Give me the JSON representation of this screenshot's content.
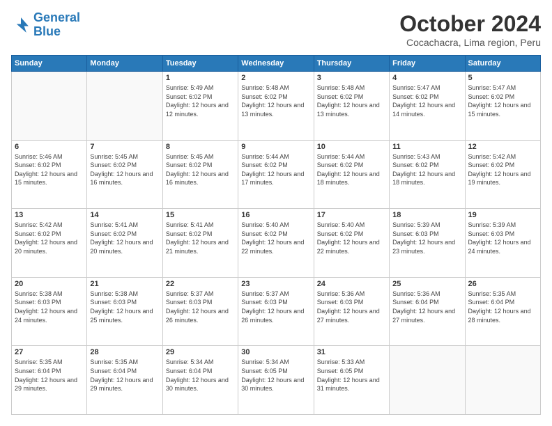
{
  "logo": {
    "line1": "General",
    "line2": "Blue"
  },
  "title": "October 2024",
  "subtitle": "Cocachacra, Lima region, Peru",
  "weekdays": [
    "Sunday",
    "Monday",
    "Tuesday",
    "Wednesday",
    "Thursday",
    "Friday",
    "Saturday"
  ],
  "weeks": [
    [
      {
        "day": "",
        "empty": true
      },
      {
        "day": "",
        "empty": true
      },
      {
        "day": "1",
        "sunrise": "5:49 AM",
        "sunset": "6:02 PM",
        "daylight": "12 hours and 12 minutes."
      },
      {
        "day": "2",
        "sunrise": "5:48 AM",
        "sunset": "6:02 PM",
        "daylight": "12 hours and 13 minutes."
      },
      {
        "day": "3",
        "sunrise": "5:48 AM",
        "sunset": "6:02 PM",
        "daylight": "12 hours and 13 minutes."
      },
      {
        "day": "4",
        "sunrise": "5:47 AM",
        "sunset": "6:02 PM",
        "daylight": "12 hours and 14 minutes."
      },
      {
        "day": "5",
        "sunrise": "5:47 AM",
        "sunset": "6:02 PM",
        "daylight": "12 hours and 15 minutes."
      }
    ],
    [
      {
        "day": "6",
        "sunrise": "5:46 AM",
        "sunset": "6:02 PM",
        "daylight": "12 hours and 15 minutes."
      },
      {
        "day": "7",
        "sunrise": "5:45 AM",
        "sunset": "6:02 PM",
        "daylight": "12 hours and 16 minutes."
      },
      {
        "day": "8",
        "sunrise": "5:45 AM",
        "sunset": "6:02 PM",
        "daylight": "12 hours and 16 minutes."
      },
      {
        "day": "9",
        "sunrise": "5:44 AM",
        "sunset": "6:02 PM",
        "daylight": "12 hours and 17 minutes."
      },
      {
        "day": "10",
        "sunrise": "5:44 AM",
        "sunset": "6:02 PM",
        "daylight": "12 hours and 18 minutes."
      },
      {
        "day": "11",
        "sunrise": "5:43 AM",
        "sunset": "6:02 PM",
        "daylight": "12 hours and 18 minutes."
      },
      {
        "day": "12",
        "sunrise": "5:42 AM",
        "sunset": "6:02 PM",
        "daylight": "12 hours and 19 minutes."
      }
    ],
    [
      {
        "day": "13",
        "sunrise": "5:42 AM",
        "sunset": "6:02 PM",
        "daylight": "12 hours and 20 minutes."
      },
      {
        "day": "14",
        "sunrise": "5:41 AM",
        "sunset": "6:02 PM",
        "daylight": "12 hours and 20 minutes."
      },
      {
        "day": "15",
        "sunrise": "5:41 AM",
        "sunset": "6:02 PM",
        "daylight": "12 hours and 21 minutes."
      },
      {
        "day": "16",
        "sunrise": "5:40 AM",
        "sunset": "6:02 PM",
        "daylight": "12 hours and 22 minutes."
      },
      {
        "day": "17",
        "sunrise": "5:40 AM",
        "sunset": "6:02 PM",
        "daylight": "12 hours and 22 minutes."
      },
      {
        "day": "18",
        "sunrise": "5:39 AM",
        "sunset": "6:03 PM",
        "daylight": "12 hours and 23 minutes."
      },
      {
        "day": "19",
        "sunrise": "5:39 AM",
        "sunset": "6:03 PM",
        "daylight": "12 hours and 24 minutes."
      }
    ],
    [
      {
        "day": "20",
        "sunrise": "5:38 AM",
        "sunset": "6:03 PM",
        "daylight": "12 hours and 24 minutes."
      },
      {
        "day": "21",
        "sunrise": "5:38 AM",
        "sunset": "6:03 PM",
        "daylight": "12 hours and 25 minutes."
      },
      {
        "day": "22",
        "sunrise": "5:37 AM",
        "sunset": "6:03 PM",
        "daylight": "12 hours and 26 minutes."
      },
      {
        "day": "23",
        "sunrise": "5:37 AM",
        "sunset": "6:03 PM",
        "daylight": "12 hours and 26 minutes."
      },
      {
        "day": "24",
        "sunrise": "5:36 AM",
        "sunset": "6:03 PM",
        "daylight": "12 hours and 27 minutes."
      },
      {
        "day": "25",
        "sunrise": "5:36 AM",
        "sunset": "6:04 PM",
        "daylight": "12 hours and 27 minutes."
      },
      {
        "day": "26",
        "sunrise": "5:35 AM",
        "sunset": "6:04 PM",
        "daylight": "12 hours and 28 minutes."
      }
    ],
    [
      {
        "day": "27",
        "sunrise": "5:35 AM",
        "sunset": "6:04 PM",
        "daylight": "12 hours and 29 minutes."
      },
      {
        "day": "28",
        "sunrise": "5:35 AM",
        "sunset": "6:04 PM",
        "daylight": "12 hours and 29 minutes."
      },
      {
        "day": "29",
        "sunrise": "5:34 AM",
        "sunset": "6:04 PM",
        "daylight": "12 hours and 30 minutes."
      },
      {
        "day": "30",
        "sunrise": "5:34 AM",
        "sunset": "6:05 PM",
        "daylight": "12 hours and 30 minutes."
      },
      {
        "day": "31",
        "sunrise": "5:33 AM",
        "sunset": "6:05 PM",
        "daylight": "12 hours and 31 minutes."
      },
      {
        "day": "",
        "empty": true
      },
      {
        "day": "",
        "empty": true
      }
    ]
  ]
}
